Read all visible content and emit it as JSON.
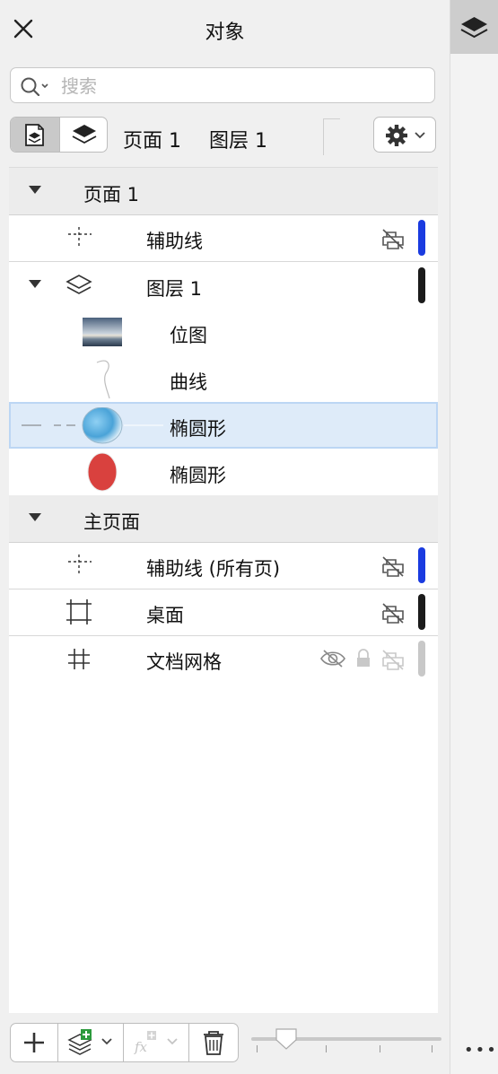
{
  "header": {
    "title": "对象"
  },
  "search": {
    "placeholder": "搜索",
    "value": ""
  },
  "breadcrumb": {
    "page": "页面 1",
    "layer": "图层 1"
  },
  "tree": {
    "page1": {
      "label": "页面 1"
    },
    "page1_guides": {
      "label": "辅助线",
      "color": "#1a3be0"
    },
    "layer1": {
      "label": "图层 1",
      "color": "#1b1b1b"
    },
    "bitmap": {
      "label": "位图"
    },
    "curve": {
      "label": "曲线"
    },
    "ellipse_blue": {
      "label": "椭圆形"
    },
    "ellipse_red": {
      "label": "椭圆形"
    },
    "master": {
      "label": "主页面"
    },
    "master_guides": {
      "label": "辅助线 (所有页)",
      "color": "#1a3be0"
    },
    "desktop": {
      "label": "桌面",
      "color": "#1b1b1b"
    },
    "grid": {
      "label": "文档网格",
      "color": "#c8c8c8"
    }
  },
  "colors": {
    "selection": "#deebf9",
    "accent_blue": "#1a3be0",
    "ellipse_red": "#d9413e"
  },
  "slider": {
    "value_fraction": 0.18
  }
}
